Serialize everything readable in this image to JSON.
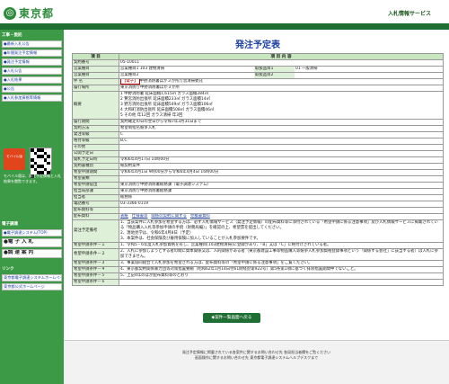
{
  "header": {
    "logo_text": "東京都",
    "logo_icon": "tokyo-mark-icon",
    "service_name": "入札情報サービス"
  },
  "sidebar": {
    "heading1": "工事・委託",
    "items1": [
      "●案件情報 (工事) 検索",
      "●入札予定 (工事) 発注予定",
      "●工事",
      "●入札結果",
      "●入札経過",
      "●工事",
      "●入札参加資格審査"
    ],
    "items2": [
      "●最新入札公告",
      "●年間発注予定情報",
      "●発注予定情報",
      "●入札公告",
      "●入札結果",
      "●公告",
      "●入札参加資格等情報"
    ],
    "badge_text": "モバイル版",
    "note": "モバイル版は、発注予定情報と入札結果を閲覧できます。",
    "heading2": "電子調達",
    "items3": [
      "●電子調達システム(TOP)",
      "●電 子 入 札",
      "●調 達 案 内"
    ],
    "heading3": "リンク",
    "items4": [
      "東京都電子調達システムホームページ",
      "東京都公式ホームページ"
    ]
  },
  "page_title": "発注予定表",
  "table": {
    "col_item": "項 目",
    "col_content": "項 目 内 容",
    "rows": [
      {
        "label": "契約番号",
        "value": "05-10011"
      },
      {
        "label": "営業種目",
        "value": "営業種目1 103 建物清掃",
        "sub_label": "取扱品目1",
        "sub_value": "01 一般清掃"
      },
      {
        "label": "営業種目",
        "value": "営業種目2",
        "sub_label": "取扱品目2",
        "sub_value": ""
      },
      {
        "label": "件 名",
        "value_tag": "【電子】",
        "value": "中野消防署ほか３か所庁舎清掃委託"
      },
      {
        "label": "履行場所",
        "value": "東京消防庁中野消防署ほか３か所"
      },
      {
        "label": "概要",
        "lines": [
          "1 中野消防署 延床面積1,615㎡ ガラス面積284㎡",
          "2 鷺宮消防出張所 延床面積233㎡ ガラス面積14㎡",
          "3 野方消防出張所 延床面積549㎡ ガラス面積106㎡",
          "4 大和町消防出張所 延床面積508㎡ ガラス面積46㎡",
          "5 その他 年12回 ガラス清掃 年3回"
        ]
      },
      {
        "label": "履行期間",
        "value": "契約確定の日の翌日から令和7年3月31日まで"
      },
      {
        "label": "契約方法",
        "value": "希望制指名競争入札"
      },
      {
        "label": "発注等級",
        "value": "C"
      },
      {
        "label": "格付等級",
        "value": "B,C"
      },
      {
        "label": "その他",
        "value": ""
      },
      {
        "label": "公開予定日",
        "value": ""
      },
      {
        "label": "開札予定日時",
        "value": "令和6年4月17日 10時00分"
      },
      {
        "label": "契約書種別",
        "value": "紙契約案件"
      },
      {
        "label": "希望申請期間",
        "value": "令和6年4月1日 9時00分から令和6年4月4日 16時00分"
      },
      {
        "label": "希望書類",
        "value": ""
      },
      {
        "label": "希望申請提出",
        "value": "東京消防庁中野消防署総務課（電子調達システム）"
      },
      {
        "label": "担当局部課",
        "value": "東京消防庁中野消防署総務課"
      },
      {
        "label": "担当者",
        "value": "総務係"
      },
      {
        "label": "電話番号",
        "value": "03-3366-0119"
      },
      {
        "label": "配布資料等",
        "value": ""
      },
      {
        "label": "配布資料",
        "links": [
          "表紙",
          "仕様書等",
          "関係の契約に関する",
          "見積書資料"
        ]
      },
      {
        "label": "発注予定備考",
        "lines": [
          "1、当該案件に入札参加を希望する方は、必ず入札情報サービス（発注予定情報）の配布資料等に添付されている「希望申請に係る注意事項」及び入札情報サービスに掲載されている「物品購入入札等参加申請の手続（財務局編）」を確認の上、希望票を提出してください。",
          "2、現地見学は、令和6年4月8日（予定）",
          "3、本案件は、社会保険及び雇用保険に加入していることが入札参加要件です。"
        ]
      },
      {
        "label": "希望申請条件－１",
        "value": "1、令和5・6年度入札参加資格を有し、営業種目[103建物清掃]に登録があり、「B」又は「C」に格付けされている者。"
      },
      {
        "label": "希望申請条件－２",
        "value": "2、入札に参加しようとする者の間に資本関係又は、人的関係がある者（東京都建設工事等物品購入等競争入札参加資格登録事項という「関係する会社」に該当する者）は入札に参加できません。"
      },
      {
        "label": "希望申請条件－３",
        "value": "3、事業協同組合で入札参加を希望される方は、配布資料等の「希望申請に係る注意事項」をご覧ください。"
      },
      {
        "label": "希望申請条件－４",
        "value": "4、東京都契約関係暴力団等対策措置要綱（昭和62年1月14日付61財経庶第922号）第5条第1項に基づく排除措置期間中でないこと。"
      },
      {
        "label": "希望申請条件－５",
        "value": "5、上記4年のほか配布資料等のとおり"
      },
      {
        "label": "希望申請条件－６",
        "value": ""
      }
    ]
  },
  "back_button": "◆案件一覧画面へ戻る",
  "footer": {
    "line1": "発注予定情報に掲載されている各案件に関するお問い合わせ先 各局担当者欄をご覧ください",
    "line2": "画面操作に関するお問い合わせ先 東京都電子調達システムヘルプデスクまで"
  }
}
